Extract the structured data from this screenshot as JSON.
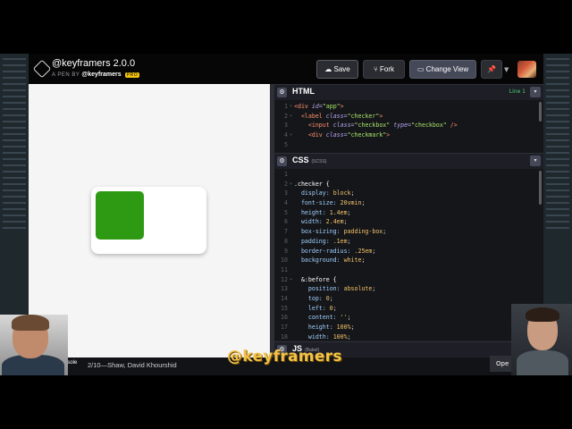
{
  "pen": {
    "title": "@keyframers 2.0.0",
    "byline_prefix": "A PEN BY",
    "author": "@keyframers",
    "badge": "PRO"
  },
  "toolbar": {
    "save_label": "Save",
    "fork_label": "Fork",
    "change_view_label": "Change View"
  },
  "html_pane": {
    "title": "HTML",
    "line_info": "Line 1",
    "lines": [
      {
        "n": "1",
        "fold": "▾",
        "html": "<span class=\"tag\">&lt;div</span> <span class=\"attr\">id=</span><span class=\"str\">\"app\"</span><span class=\"tag\">&gt;</span>"
      },
      {
        "n": "2",
        "fold": "▾",
        "html": "  <span class=\"tag\">&lt;label</span> <span class=\"attr\">class=</span><span class=\"str\">\"checker\"</span><span class=\"tag\">&gt;</span>"
      },
      {
        "n": "3",
        "fold": "",
        "html": "    <span class=\"tag\">&lt;input</span> <span class=\"attr\">class=</span><span class=\"str\">\"checkbox\"</span> <span class=\"attr\">type=</span><span class=\"str\">\"checkbox\"</span> <span class=\"tag\">/&gt;</span>"
      },
      {
        "n": "4",
        "fold": "▾",
        "html": "    <span class=\"tag\">&lt;div</span> <span class=\"attr\">class=</span><span class=\"str\">\"checkmark\"</span><span class=\"tag\">&gt;</span>"
      },
      {
        "n": "5",
        "fold": "",
        "html": ""
      }
    ]
  },
  "css_pane": {
    "title": "CSS",
    "subtitle": "(SCSS)",
    "lines": [
      {
        "n": "1",
        "fold": "",
        "html": ""
      },
      {
        "n": "2",
        "fold": "▾",
        "html": "<span class=\"sel\">.checker {</span>"
      },
      {
        "n": "3",
        "fold": "",
        "html": "  <span class=\"prop\">display:</span> <span class=\"val\">block</span>;"
      },
      {
        "n": "4",
        "fold": "",
        "html": "  <span class=\"prop\">font-size:</span> <span class=\"val\">20vmin</span>;"
      },
      {
        "n": "5",
        "fold": "",
        "html": "  <span class=\"prop\">height:</span> <span class=\"val\">1.4em</span>;"
      },
      {
        "n": "6",
        "fold": "",
        "html": "  <span class=\"prop\">width:</span> <span class=\"val\">2.4em</span>;"
      },
      {
        "n": "7",
        "fold": "",
        "html": "  <span class=\"prop\">box-sizing:</span> <span class=\"val\">padding-box</span>;"
      },
      {
        "n": "8",
        "fold": "",
        "html": "  <span class=\"prop\">padding:</span> <span class=\"val\">.1em</span>;"
      },
      {
        "n": "9",
        "fold": "",
        "html": "  <span class=\"prop\">border-radius:</span> <span class=\"val\">.25em</span>;"
      },
      {
        "n": "10",
        "fold": "",
        "html": "  <span class=\"prop\">background:</span> <span class=\"val\">white</span>;"
      },
      {
        "n": "11",
        "fold": "",
        "html": ""
      },
      {
        "n": "12",
        "fold": "▾",
        "html": "  <span class=\"sel\">&amp;:before {</span>"
      },
      {
        "n": "13",
        "fold": "",
        "html": "    <span class=\"prop\">position:</span> <span class=\"val\">absolute</span>;"
      },
      {
        "n": "14",
        "fold": "",
        "html": "    <span class=\"prop\">top:</span> <span class=\"val\">0</span>;"
      },
      {
        "n": "15",
        "fold": "",
        "html": "    <span class=\"prop\">left:</span> <span class=\"val\">0</span>;"
      },
      {
        "n": "16",
        "fold": "",
        "html": "    <span class=\"prop\">content:</span> <span class=\"str\">''</span>;"
      },
      {
        "n": "17",
        "fold": "",
        "html": "    <span class=\"prop\">height:</span> <span class=\"val\">100%</span>;"
      },
      {
        "n": "18",
        "fold": "",
        "html": "    <span class=\"prop\">width:</span> <span class=\"val\">100%</span>;"
      }
    ]
  },
  "js_pane": {
    "title": "JS",
    "subtitle": "(Babel)"
  },
  "status": {
    "console_label": "nsole",
    "breadcrumb": "2/10—Shaw, David Khourshid",
    "open_label": "Ope"
  },
  "overlay": {
    "handle": "@keyframers"
  },
  "colors": {
    "checker_knob": "#2e9a14",
    "handle": "#f2c24a",
    "accent_green": "#47cf73"
  }
}
